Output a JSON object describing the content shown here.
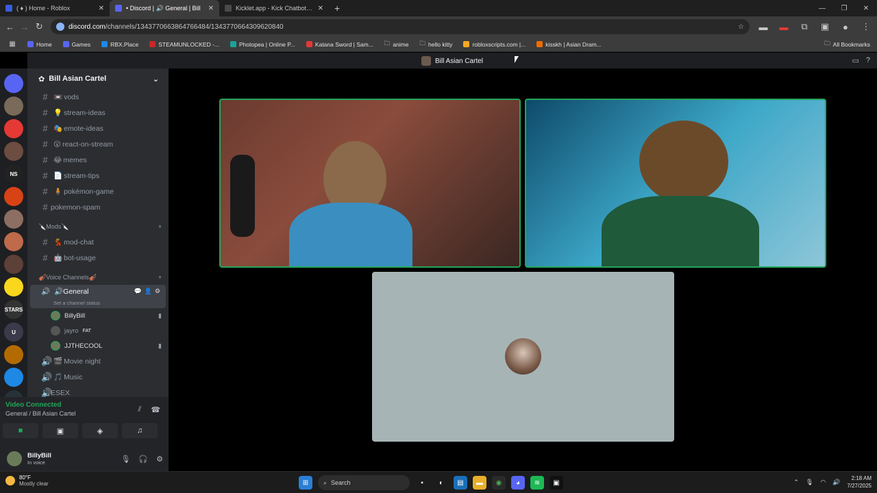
{
  "browser": {
    "tabs": [
      {
        "title": "( ♦ ) Home - Roblox",
        "icon": "roblox-icon",
        "color": "#3b5bdb"
      },
      {
        "title": "• Discord | 🔊 General | Bill",
        "icon": "discord-icon",
        "color": "#5865f2"
      },
      {
        "title": "Kicklet.app - Kick Chatbot and",
        "icon": "kicklet-icon",
        "color": "#4a4a4a"
      }
    ],
    "new_tab": "+",
    "url_domain": "discord.com",
    "url_path": "/channels/1343770663864766484/1343770664309620840",
    "bookmarks": [
      {
        "label": "Home",
        "color": "#5865f2"
      },
      {
        "label": "Games",
        "color": "#5865f2"
      },
      {
        "label": "RBX.Place",
        "color": "#1e88e5"
      },
      {
        "label": "STEAMUNLOCKED -...",
        "color": "#c62828"
      },
      {
        "label": "Photopea | Online P...",
        "color": "#18a497"
      },
      {
        "label": "Katana Sword | Sam...",
        "color": "#e53935"
      },
      {
        "label": "anime",
        "color": "#9e9e9e"
      },
      {
        "label": "hello kitty",
        "color": "#9e9e9e"
      },
      {
        "label": "robloxscripts.com |...",
        "color": "#f9a825"
      },
      {
        "label": "kisskh | Asian Dram...",
        "color": "#ef6c00"
      }
    ],
    "all_bookmarks": "All Bookmarks"
  },
  "discord": {
    "server_name": "Bill Asian Cartel",
    "server_icons": [
      {
        "label": "",
        "color": "#5865f2"
      },
      {
        "label": "",
        "color": "#7a6a5a"
      },
      {
        "label": "",
        "color": "#e53935"
      },
      {
        "label": "",
        "color": "#6d4c41"
      },
      {
        "label": "NS",
        "color": "#222"
      },
      {
        "label": "",
        "color": "#d84315"
      },
      {
        "label": "",
        "color": "#8d6e63"
      },
      {
        "label": "",
        "color": "#bf6a4a"
      },
      {
        "label": "",
        "color": "#5d4037"
      },
      {
        "label": "",
        "color": "#f9d71c"
      },
      {
        "label": "STARS",
        "color": "#333"
      },
      {
        "label": "U",
        "color": "#3a3a4a"
      },
      {
        "label": "",
        "color": "#b36b00"
      },
      {
        "label": "",
        "color": "#1e88e5"
      },
      {
        "label": "",
        "color": "#263238"
      },
      {
        "label": "",
        "color": "#7b1f1f"
      }
    ],
    "channels": [
      {
        "emoji": "📼",
        "name": "vods"
      },
      {
        "emoji": "💡",
        "name": "stream-ideas"
      },
      {
        "emoji": "🎭",
        "name": "emote-ideas"
      },
      {
        "emoji": "😮",
        "name": "react-on-stream"
      },
      {
        "emoji": "😂",
        "name": "memes"
      },
      {
        "emoji": "📄",
        "name": "stream-tips"
      },
      {
        "emoji": "🧍",
        "name": "pokémon-game"
      },
      {
        "emoji": "",
        "name": "pokemon-spam"
      }
    ],
    "mods_category": "🔪Mods🔪",
    "mod_channels": [
      {
        "emoji": "💃",
        "name": "mod-chat"
      },
      {
        "emoji": "🤖",
        "name": "bot-usage"
      }
    ],
    "voice_category": "🎻Voice Channels🎻",
    "active_voice": {
      "name": "🔊General",
      "status": "Set a channel status"
    },
    "members": [
      {
        "name": "BillyBill",
        "tag": "",
        "cam": true
      },
      {
        "name": "jayro",
        "tag": "FAT",
        "cam": false
      },
      {
        "name": "JJTHECOOL",
        "tag": "",
        "cam": true
      }
    ],
    "other_voice": [
      {
        "emoji": "🎬",
        "name": "Movie night"
      },
      {
        "emoji": "🎵",
        "name": "Music"
      },
      {
        "emoji": "",
        "name": "ESEX"
      }
    ],
    "voice_panel": {
      "title": "Video Connected",
      "subtitle": "General / Bill Asian Cartel"
    },
    "user": {
      "name": "BillyBill",
      "status": "In voice"
    }
  },
  "taskbar": {
    "temp": "80°F",
    "weather": "Mostly clear",
    "search": "Search",
    "time": "2:18 AM",
    "date": "7/27/2025"
  },
  "colors": {
    "accent": "#23a55a",
    "blurple": "#5865f2"
  }
}
